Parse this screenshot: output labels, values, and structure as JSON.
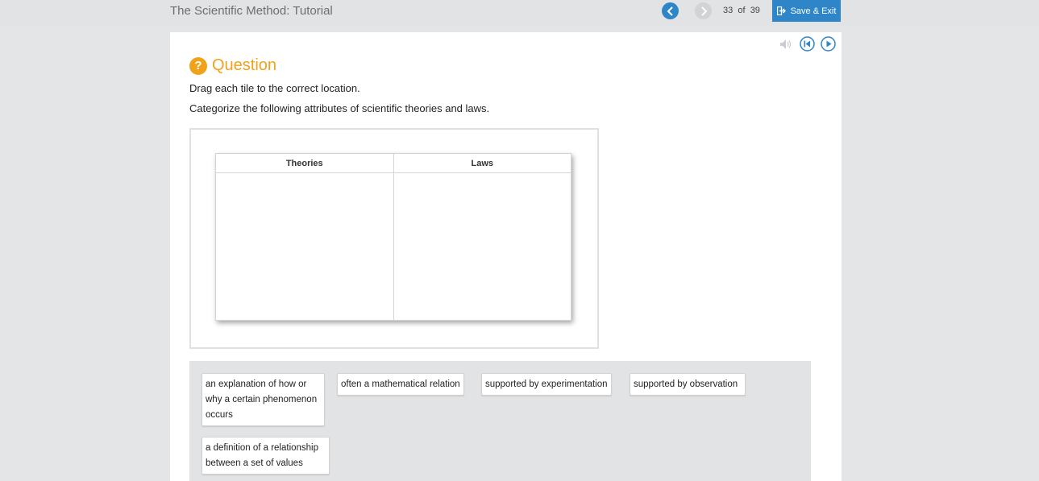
{
  "header": {
    "course_title": "The Scientific Method: Tutorial",
    "page_current": "33",
    "page_of": "of",
    "page_total": "39",
    "save_exit_label": "Save & Exit"
  },
  "question": {
    "badge": "?",
    "title": "Question",
    "instruction": "Drag each tile to the correct location.",
    "prompt": "Categorize the following attributes of scientific theories and laws."
  },
  "table": {
    "columns": [
      "Theories",
      "Laws"
    ]
  },
  "tiles": [
    "an explanation of how or why a certain phenomenon occurs",
    "often a mathematical relation",
    "supported by experimentation",
    "supported by observation",
    "a definition of a relationship between a set of values"
  ],
  "colors": {
    "accent_blue": "#2e86c8",
    "question_orange": "#f0a21b"
  },
  "icons": [
    "back-arrow-icon",
    "forward-arrow-icon",
    "exit-icon",
    "speaker-mute-icon",
    "rewind-icon",
    "play-icon"
  ]
}
